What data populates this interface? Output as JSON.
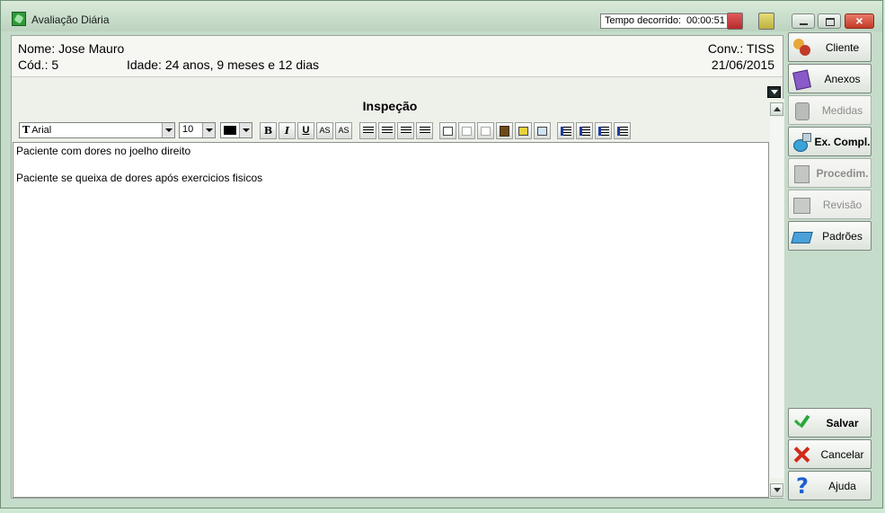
{
  "window": {
    "title": "Avaliação Diária",
    "timer_label": "Tempo decorrido:",
    "timer_value": "00:00:51",
    "close_glyph": "×",
    "colors": {
      "accent_red": "#c23a2a",
      "accent_yellow": "#cfc55a"
    }
  },
  "patient": {
    "name_line": "Nome: Jose Mauro",
    "code_line": "Cód.: 5",
    "age_line": "Idade: 24 anos, 9 meses e 12 dias",
    "conv_line": "Conv.: TISS",
    "date": "21/06/2015"
  },
  "section": {
    "title": "Inspeção"
  },
  "toolbar": {
    "font_name": "Arial",
    "font_icon": "T",
    "font_size": "10",
    "bold": "B",
    "italic": "I",
    "underline": "U",
    "superscript": "AS",
    "subscript": "AS"
  },
  "editor": {
    "lines": [
      "Paciente com dores no joelho direito",
      "Paciente se queixa de dores após exercicios fisicos"
    ]
  },
  "sidebar": {
    "cliente": "Cliente",
    "anexos": "Anexos",
    "medidas": "Medidas",
    "ex_compl": "Ex. Compl.",
    "procedim": "Procedim.",
    "revisao": "Revisão",
    "padroes": "Padrões",
    "salvar": "Salvar",
    "cancelar": "Cancelar",
    "ajuda": "Ajuda",
    "help_glyph": "?"
  }
}
